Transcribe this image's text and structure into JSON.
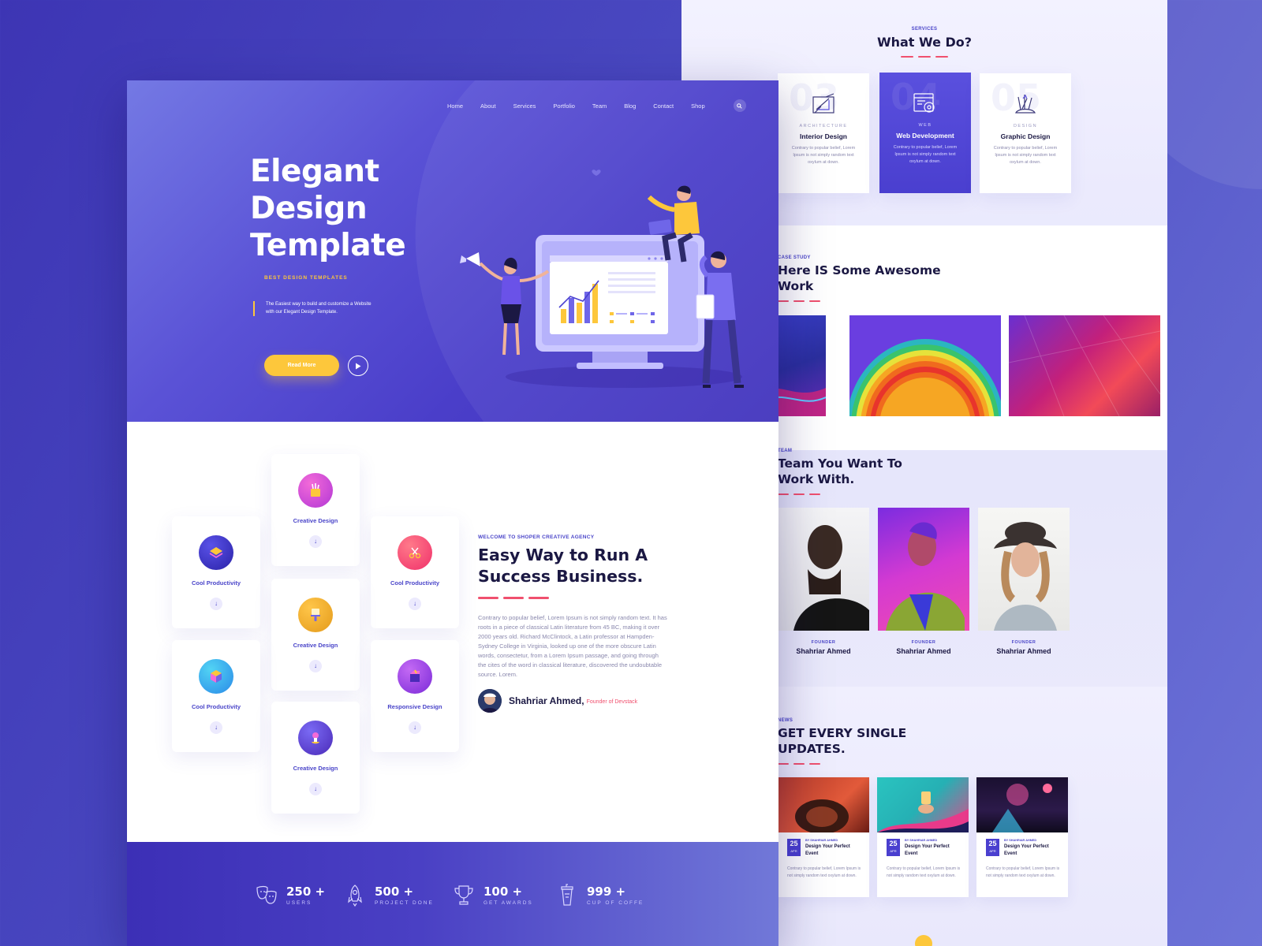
{
  "services": {
    "eyebrow": "SERVICES",
    "title": "What We Do?",
    "cards": [
      {
        "num": "03",
        "category": "ARCHITECTURE",
        "title": "Interior Design",
        "text": "Contrary to popular belief, Lorem Ipsum is not simply random text oxylum at down.",
        "icon": "ruler-pencil-icon"
      },
      {
        "num": "04",
        "category": "WEB",
        "title": "Web Development",
        "text": "Contrary to popular belief, Lorem Ipsum is not simply random text oxylum at down.",
        "icon": "browser-gear-icon"
      },
      {
        "num": "05",
        "category": "DESIGN",
        "title": "Graphic Design",
        "text": "Contrary to popular belief, Lorem Ipsum is not simply random text oxylum at down.",
        "icon": "brushes-icon"
      }
    ]
  },
  "work": {
    "eyebrow": "CASE STUDY",
    "title_line1": "Here IS Some Awesome",
    "title_line2": "Work"
  },
  "team": {
    "eyebrow": "TEAM",
    "title_line1": "Team You Want To",
    "title_line2": "Work With.",
    "members": [
      {
        "role": "FOUNDER",
        "name": "Shahriar Ahmed"
      },
      {
        "role": "FOUNDER",
        "name": "Shahriar Ahmed"
      },
      {
        "role": "FOUNDER",
        "name": "Shahriar Ahmed"
      }
    ]
  },
  "news": {
    "eyebrow": "NEWS",
    "title_line1": "GET EVERY SINGLE",
    "title_line2": "UPDATES.",
    "posts": [
      {
        "day": "25",
        "month": "APR",
        "by": "BY SHAHRIAR AHMED",
        "title": "Design Your Perfect Event",
        "text": "Contrary to popular belief, Lorem Ipsum is not simply random text oxylum at down."
      },
      {
        "day": "25",
        "month": "APR",
        "by": "BY SHAHRIAR AHMED",
        "title": "Design Your Perfect Event",
        "text": "Contrary to popular belief, Lorem Ipsum is not simply random text oxylum at down."
      },
      {
        "day": "25",
        "month": "APR",
        "by": "BY SHAHRIAR AHMED",
        "title": "Design Your Perfect Event",
        "text": "Contrary to popular belief, Lorem Ipsum is not simply random text oxylum at down."
      }
    ]
  },
  "nav": {
    "items": [
      "Home",
      "About",
      "Services",
      "Portfolio",
      "Team",
      "Blog",
      "Contact",
      "Shop"
    ],
    "search_icon": "search-icon"
  },
  "hero": {
    "title_line1": "Elegant",
    "title_line2": "Design",
    "title_line3": "Template",
    "eyebrow": "BEST DESIGN TEMPLATES",
    "description": "The Easiest way to build and customize a Website with our Elegant Design Template.",
    "cta": "Read More",
    "accent": "#fdc73b"
  },
  "features": [
    {
      "label": "Creative Design",
      "icon": "pencil-cup-icon"
    },
    {
      "label": "Cool Productivity",
      "icon": "layers-icon"
    },
    {
      "label": "Cool Productivity",
      "icon": "scissors-icon"
    },
    {
      "label": "Creative Design",
      "icon": "paint-brush-icon"
    },
    {
      "label": "Cool Productivity",
      "icon": "cube-icon"
    },
    {
      "label": "Responsive Design",
      "icon": "box-icon"
    },
    {
      "label": "Creative Design",
      "icon": "lightbulb-icon"
    }
  ],
  "about": {
    "eyebrow": "WELCOME TO SHOPER CREATIVE AGENCY",
    "title_line1": "Easy Way to Run A",
    "title_line2": "Success Business.",
    "text": "Contrary to popular belief, Lorem Ipsum is not simply random text. It has roots in a piece of classical Latin literature from 45 BC, making it over 2000 years old. Richard McClintock, a Latin professor at Hampden-Sydney College in Virginia, looked up one of the more obscure Latin words, consectetur, from a Lorem Ipsum passage, and going through the cites of the word in classical literature, discovered the undoubtable source. Lorem.",
    "author_name": "Shahriar Ahmed,",
    "author_role": "Founder of Devstack"
  },
  "stats": [
    {
      "value": "250 +",
      "label": "USERS",
      "icon": "masks-icon"
    },
    {
      "value": "500 +",
      "label": "PROJECT DONE",
      "icon": "rocket-icon"
    },
    {
      "value": "100 +",
      "label": "GET AWARDS",
      "icon": "trophy-icon"
    },
    {
      "value": "999 +",
      "label": "CUP OF COFFE",
      "icon": "coffee-cup-icon"
    }
  ],
  "colors": {
    "primary": "#4a3fcf",
    "accent_yellow": "#fdc73b",
    "accent_red": "#f0506e",
    "dark": "#1b1843"
  }
}
